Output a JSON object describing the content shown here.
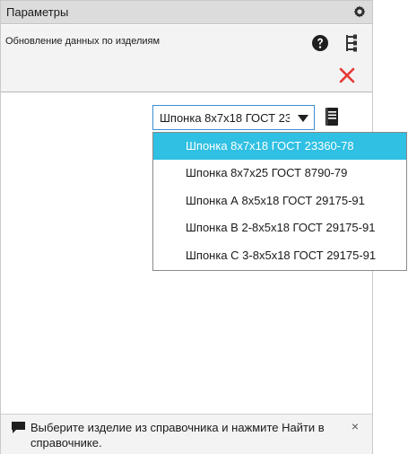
{
  "panel": {
    "title": "Параметры",
    "subtitle": "Обновление данных по изделиям"
  },
  "icons": {
    "settings": "gear-icon",
    "help": "help-icon",
    "tree": "tree-structure-icon",
    "close": "close-icon",
    "catalog": "book-icon",
    "dropdown": "chevron-down-icon",
    "message": "message-icon",
    "dismiss": "close-icon"
  },
  "selector": {
    "value": "Шпонка 8x7x18 ГОСТ 23360-78",
    "options": [
      "Шпонка 8x7x18 ГОСТ 23360-78",
      "Шпонка 8x7x25 ГОСТ 8790-79",
      "Шпонка А 8x5x18 ГОСТ 29175-91",
      "Шпонка В 2-8x5x18 ГОСТ 29175-91",
      "Шпонка С 3-8x5x18 ГОСТ 29175-91"
    ],
    "selected_index": 0
  },
  "status": {
    "message": "Выберите изделие из справочника и нажмите Найти в справочнике.",
    "dismiss_label": "×"
  },
  "colors": {
    "accent": "#2fc0e3",
    "close_red": "#e53935",
    "titlebar": "#dcdcdc"
  }
}
